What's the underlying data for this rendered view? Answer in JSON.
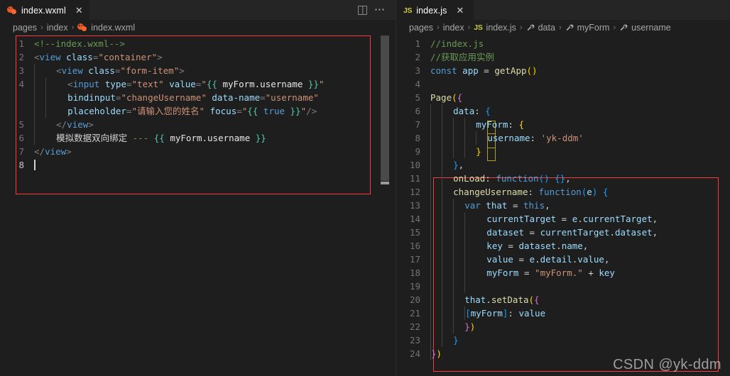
{
  "window": {
    "background": "#1e1e1e",
    "accent_annotation_color": "#fb3b3b"
  },
  "left_pane": {
    "tab": {
      "icon": "wxml-file-icon",
      "label": "index.wxml",
      "close_label": "✕"
    },
    "actions": [
      {
        "icon": "split-editor-icon",
        "label": "Split Editor"
      },
      {
        "icon": "more-actions-icon",
        "label": "···"
      }
    ],
    "breadcrumb": [
      {
        "label": "pages",
        "icon": null
      },
      {
        "label": "index",
        "icon": null
      },
      {
        "label": "index.wxml",
        "icon": "wxml-file-icon"
      }
    ],
    "breadcrumb_separator": "›",
    "lines": [
      {
        "n": "1"
      },
      {
        "n": "2"
      },
      {
        "n": "3"
      },
      {
        "n": "4"
      },
      {
        "n": ""
      },
      {
        "n": ""
      },
      {
        "n": "5"
      },
      {
        "n": "6"
      },
      {
        "n": "7"
      },
      {
        "n": "8"
      }
    ],
    "code_lines": [
      "<!--index.wxml-->",
      "<view class=\"container\">",
      "    <view class=\"form-item\">",
      "        <input type=\"text\" value=\"{{ myForm.username }}\"",
      "        bindinput=\"changeUsername\" data-name=\"username\"",
      "        placeholder=\"请输入您的姓名\" focus=\"{{ true }}\"/>",
      "    </view>",
      "    模拟数据双向绑定 --- {{ myForm.username }}",
      "</view>",
      ""
    ]
  },
  "right_pane": {
    "tab": {
      "icon": "js-file-icon",
      "icon_text": "JS",
      "label": "index.js",
      "close_label": "✕"
    },
    "breadcrumb": [
      {
        "label": "pages",
        "icon": null
      },
      {
        "label": "index",
        "icon": null
      },
      {
        "label": "index.js",
        "icon": "js-file-icon",
        "icon_text": "JS"
      },
      {
        "label": "data",
        "icon": "property-icon"
      },
      {
        "label": "myForm",
        "icon": "property-icon"
      },
      {
        "label": "username",
        "icon": "property-icon"
      }
    ],
    "breadcrumb_separator": "›",
    "lines": [
      "1",
      "2",
      "3",
      "4",
      "5",
      "6",
      "7",
      "8",
      "9",
      "10",
      "11",
      "12",
      "13",
      "14",
      "15",
      "16",
      "17",
      "18",
      "19",
      "20",
      "21",
      "22",
      "23",
      "24"
    ],
    "code_lines": [
      "//index.js",
      "//获取应用实例",
      "const app = getApp()",
      "",
      "Page({",
      "    data: {",
      "        myForm: {",
      "            username: 'yk-ddm'",
      "        }",
      "    },",
      "    onLoad: function() {},",
      "    changeUsername: function(e) {",
      "        var that = this,",
      "            currentTarget = e.currentTarget,",
      "            dataset = currentTarget.dataset,",
      "            key = dataset.name,",
      "            value = e.detail.value,",
      "            myForm = \"myForm.\" + key",
      "",
      "        that.setData({",
      "          [myForm]: value",
      "        })",
      "    }",
      "})"
    ]
  },
  "watermark": {
    "text": "CSDN @yk-ddm"
  }
}
